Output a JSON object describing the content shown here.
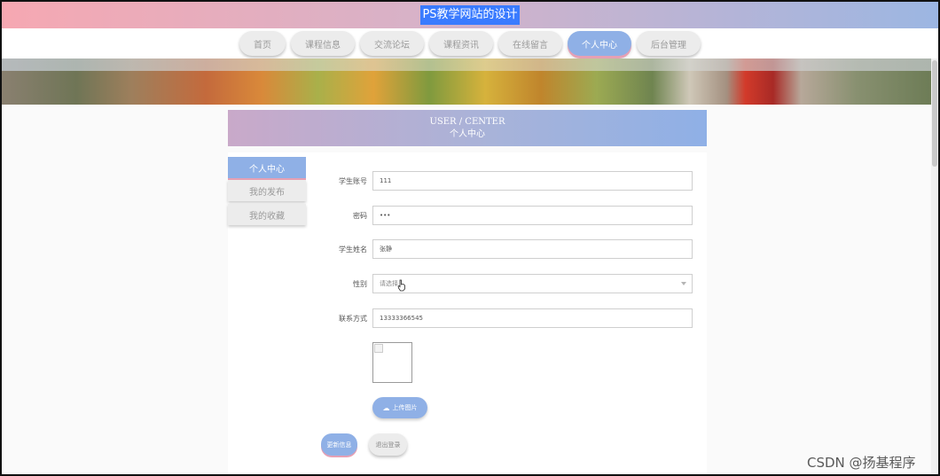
{
  "app": {
    "title": "PS教学网站的设计"
  },
  "nav": {
    "items": [
      {
        "label": "首页",
        "active": false
      },
      {
        "label": "课程信息",
        "active": false
      },
      {
        "label": "交流论坛",
        "active": false
      },
      {
        "label": "课程资讯",
        "active": false
      },
      {
        "label": "在线留言",
        "active": false
      },
      {
        "label": "个人中心",
        "active": true
      },
      {
        "label": "后台管理",
        "active": false
      }
    ]
  },
  "header": {
    "en": "USER / CENTER",
    "cn": "个人中心"
  },
  "sidebar": {
    "items": [
      {
        "label": "个人中心",
        "active": true
      },
      {
        "label": "我的发布",
        "active": false
      },
      {
        "label": "我的收藏",
        "active": false
      }
    ]
  },
  "form": {
    "account": {
      "label": "学生账号",
      "value": "111"
    },
    "password": {
      "label": "密码",
      "value": "•••"
    },
    "name": {
      "label": "学生姓名",
      "value": "张静"
    },
    "gender": {
      "label": "性别",
      "placeholder": "请选择"
    },
    "phone": {
      "label": "联系方式",
      "value": "13333366545"
    },
    "upload_label": "上传图片"
  },
  "actions": {
    "update_label": "更新信息",
    "logout_label": "退出登录"
  },
  "watermark": "CSDN @扬基程序",
  "colors": {
    "accent": "#8fb0e6",
    "pink": "#e6a0b4"
  }
}
